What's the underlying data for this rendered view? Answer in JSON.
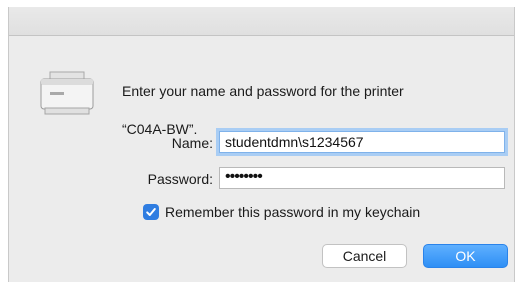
{
  "dialog": {
    "message_line1": "Enter your name and password for the printer",
    "message_line2": "“C04A-BW”.",
    "icon": "printer-icon"
  },
  "form": {
    "name_label": "Name:",
    "name_value": "studentdmn\\s1234567",
    "password_label": "Password:",
    "password_value": "••••••••",
    "remember_label": "Remember this password in my keychain",
    "remember_checked": true
  },
  "buttons": {
    "cancel_label": "Cancel",
    "ok_label": "OK"
  },
  "colors": {
    "accent": "#2f7de1",
    "focus_ring": "#a9cdf4",
    "dialog_bg": "#ececec"
  }
}
